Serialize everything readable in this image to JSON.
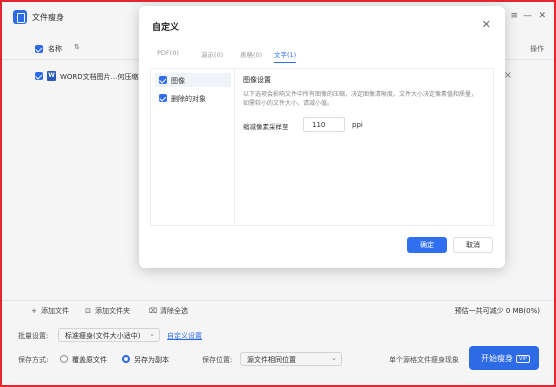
{
  "app": {
    "title": "文件瘦身"
  },
  "window": {
    "menu_icon": "≡",
    "minimize_icon": "—",
    "close_icon": "✕"
  },
  "list": {
    "header_name": "名称",
    "sort_icon": "⇅",
    "header_op": "操作",
    "files": [
      {
        "name": "WORD文档图片...何压缩.d"
      }
    ]
  },
  "toolbar": {
    "add_file": "添加文件",
    "add_folder": "添加文件夹",
    "clear_all": "清除全选",
    "summary": "预估一共可减少 0 MB(0%)"
  },
  "settings": {
    "batch_label": "批量设置:",
    "batch_value": "标准瘦身(文件大小适中)",
    "custom_link": "自定义设置",
    "save_mode_label": "保存方式:",
    "save_overwrite": "覆盖原文件",
    "save_as_copy": "另存为副本",
    "save_location_label": "保存位置:",
    "save_location_value": "源文件相同位置",
    "merge_label": "单个源格文件瘦身现象",
    "start_button": "开始瘦身",
    "vip_badge": "VIP"
  },
  "dialog": {
    "title": "自定义",
    "tabs": [
      {
        "label": "PDF(0)",
        "active": false
      },
      {
        "label": "演示(0)",
        "active": false
      },
      {
        "label": "表格(0)",
        "active": false
      },
      {
        "label": "文字(1)",
        "active": true
      }
    ],
    "sidebar": [
      {
        "label": "图像",
        "checked": true,
        "selected": true
      },
      {
        "label": "删除的对象",
        "checked": true,
        "selected": false
      }
    ],
    "panel": {
      "title": "图像设置",
      "description": "以下选项会影响文件中所有图像的压缩，决定图像清晰度。文件大小决定像素值和质量，如需较小的文件大小，请减小值。",
      "field_label": "缩减像素采样至",
      "field_value": "110",
      "field_unit": "ppi"
    },
    "ok_label": "确定",
    "cancel_label": "取消"
  },
  "colors": {
    "accent": "#2f6ff0",
    "frame": "#e0282e"
  }
}
